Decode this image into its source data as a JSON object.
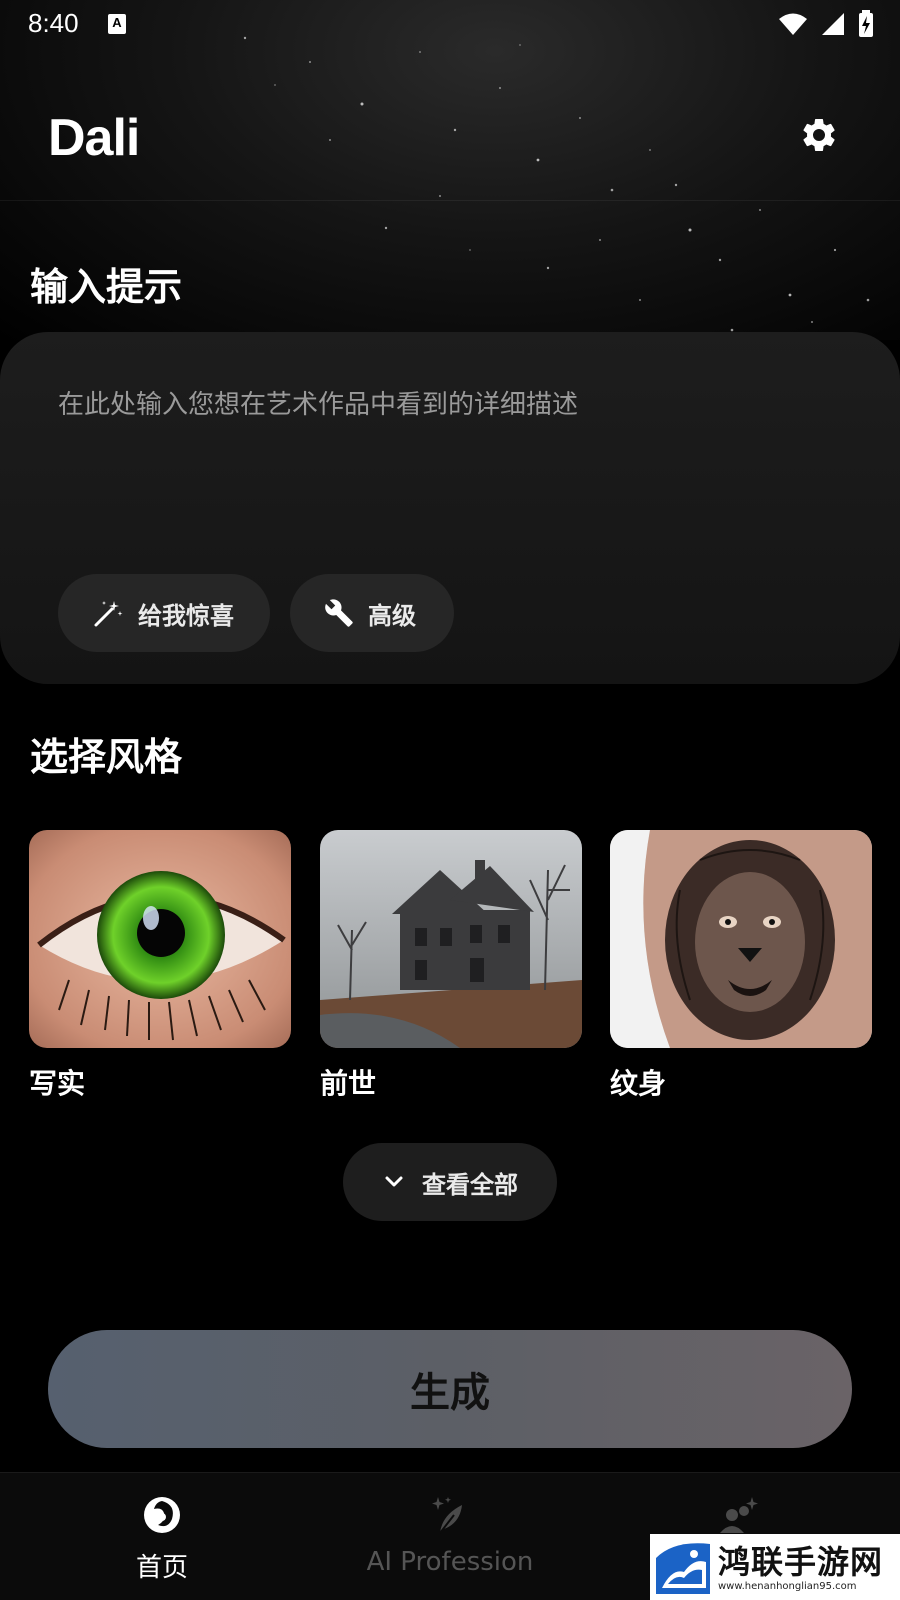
{
  "status_bar": {
    "time": "8:40",
    "notification_icon_letter": "A",
    "icons": [
      "wifi-icon",
      "signal-icon",
      "battery-icon"
    ]
  },
  "app_bar": {
    "title": "Dali",
    "settings_icon": "gear-icon"
  },
  "prompt_section": {
    "title": "输入提示",
    "placeholder": "在此处输入您想在艺术作品中看到的详细描述",
    "surprise_label": "给我惊喜",
    "surprise_icon": "magic-wand-icon",
    "advanced_label": "高级",
    "advanced_icon": "wrench-icon"
  },
  "style_section": {
    "title": "选择风格",
    "styles": [
      {
        "label": "写实",
        "image": "green-eye-closeup"
      },
      {
        "label": "前世",
        "image": "haunted-house-fog"
      },
      {
        "label": "纹身",
        "image": "lion-tattoo-arm"
      }
    ],
    "view_all_label": "查看全部",
    "view_all_icon": "chevron-down-icon"
  },
  "generate_label": "生成",
  "colors": {
    "background": "#000000",
    "card": "#1a1a1a",
    "chip": "#262626",
    "generate_gradient_start": "#56606f",
    "generate_gradient_end": "#6a6367",
    "nav_active": "#ffffff",
    "nav_inactive": "#5a5a5a"
  },
  "bottom_nav": {
    "items": [
      {
        "label": "首页",
        "icon": "dali-swirl-icon",
        "active": true
      },
      {
        "label": "AI Profession",
        "icon": "sparkle-feather-icon",
        "active": false
      },
      {
        "label": "",
        "icon": "users-sparkle-icon",
        "active": false
      }
    ]
  },
  "watermark": {
    "title": "鸿联手游网",
    "url": "www.henanhonglian95.com"
  }
}
